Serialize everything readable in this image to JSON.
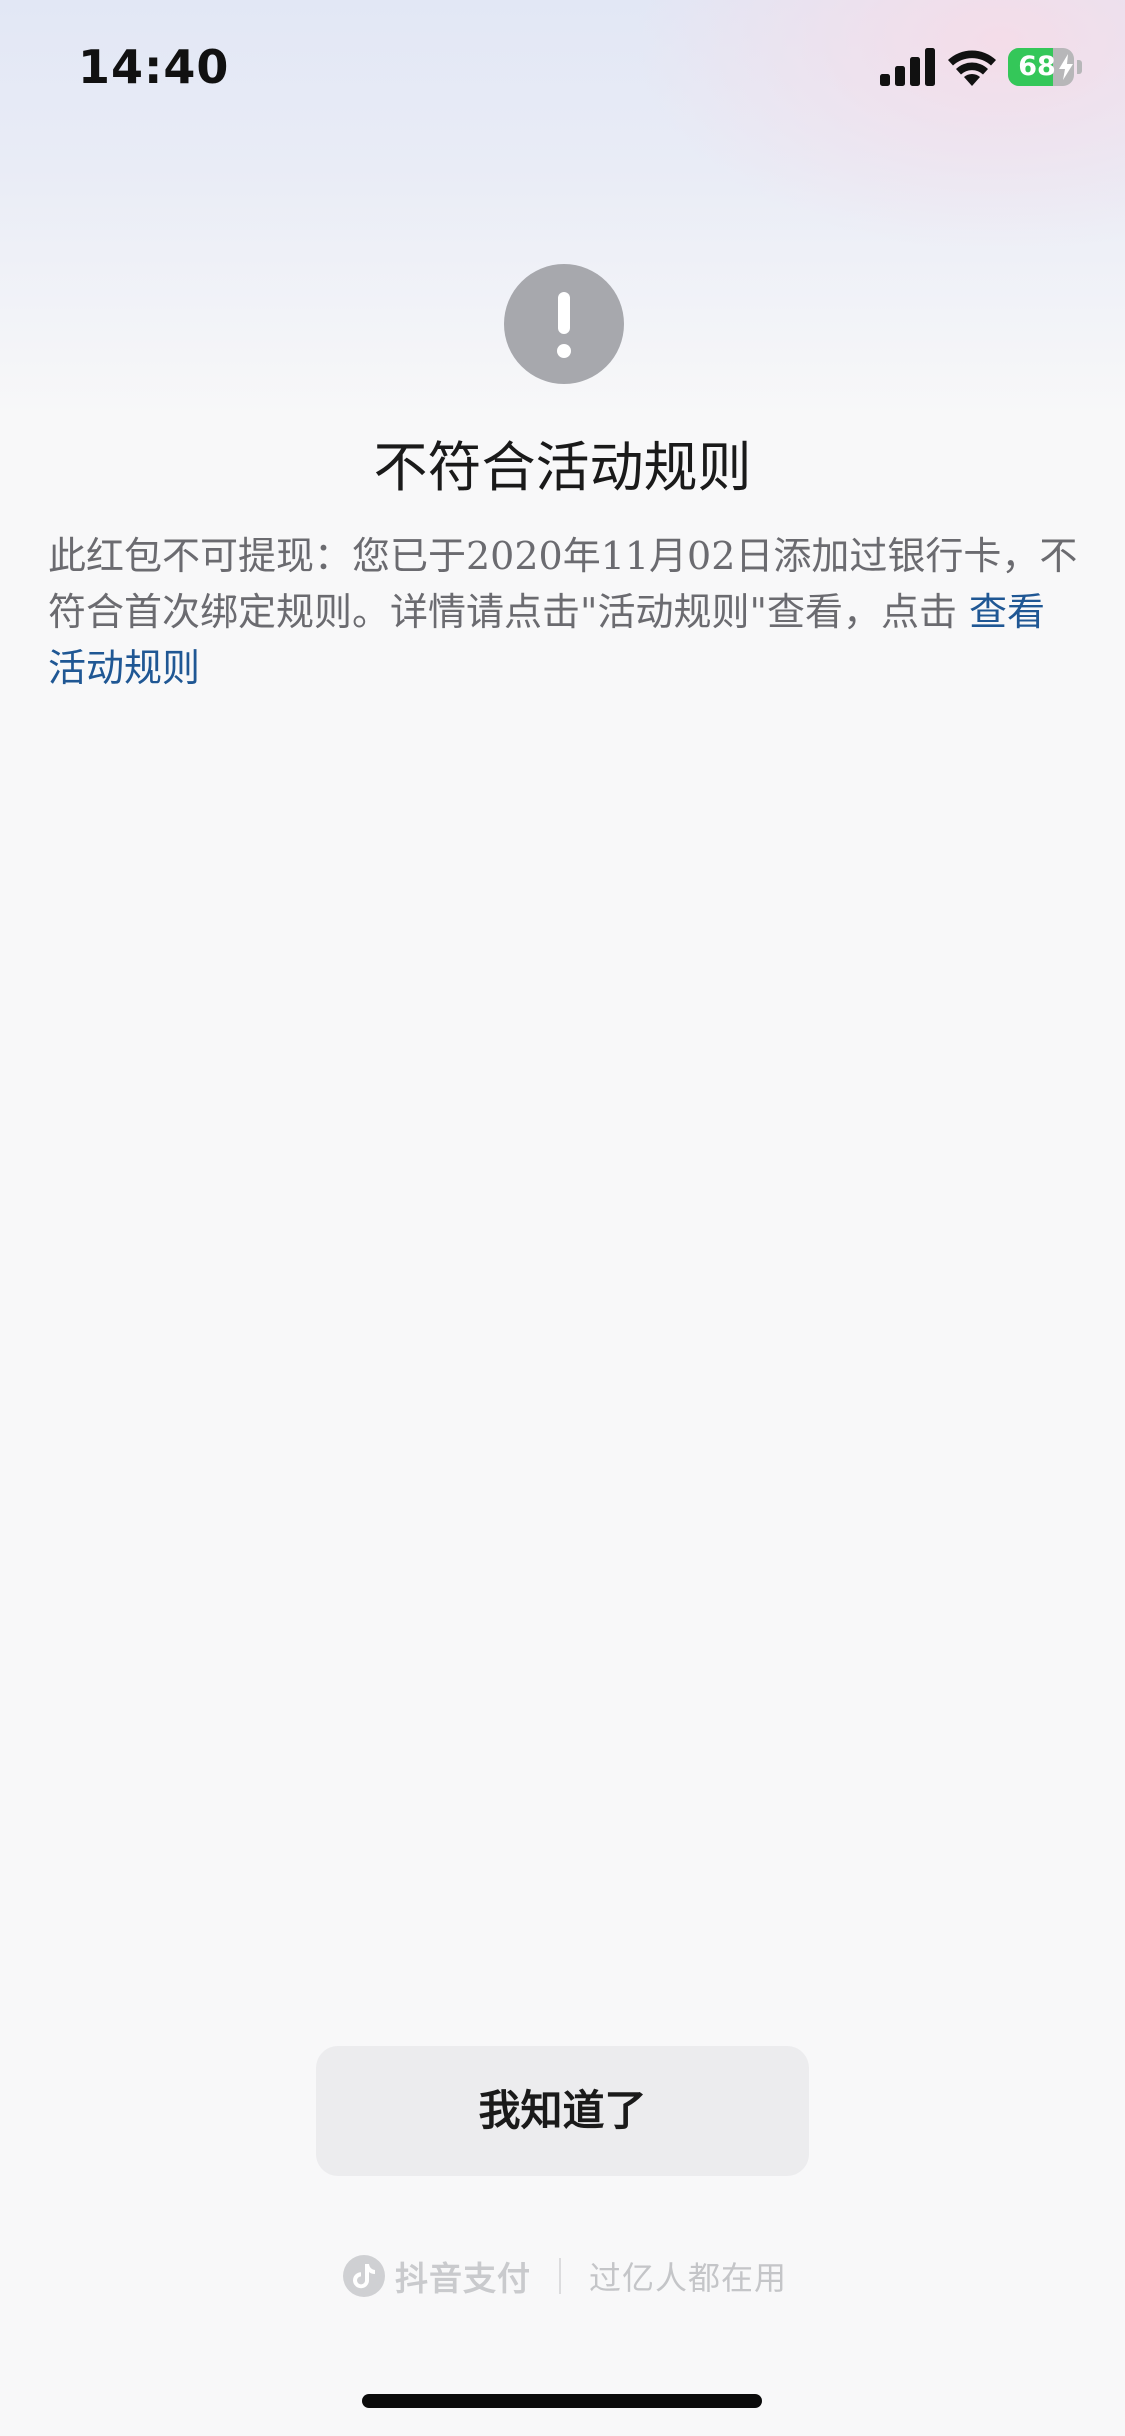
{
  "status_bar": {
    "time": "14:40",
    "battery_level": "68",
    "battery_percent": 68,
    "icons": [
      "cellular-signal-icon",
      "wifi-icon",
      "battery-charging-icon"
    ]
  },
  "dialog": {
    "icon": "exclamation-icon",
    "title": "不符合活动规则",
    "message": "此红包不可提现：您已于2020年11月02日添加过银行卡，不符合首次绑定规则。详情请点击\"活动规则\"查看，点击 ",
    "link_label": "查看活动规则",
    "confirm_label": "我知道了"
  },
  "footer": {
    "brand_icon": "tiktok-logo-icon",
    "brand": "抖音支付",
    "slogan": "过亿人都在用"
  },
  "colors": {
    "accent_link": "#1f5794",
    "icon_gray": "#a7a8ad",
    "button_bg": "#ececee",
    "battery_green": "#34c759"
  }
}
